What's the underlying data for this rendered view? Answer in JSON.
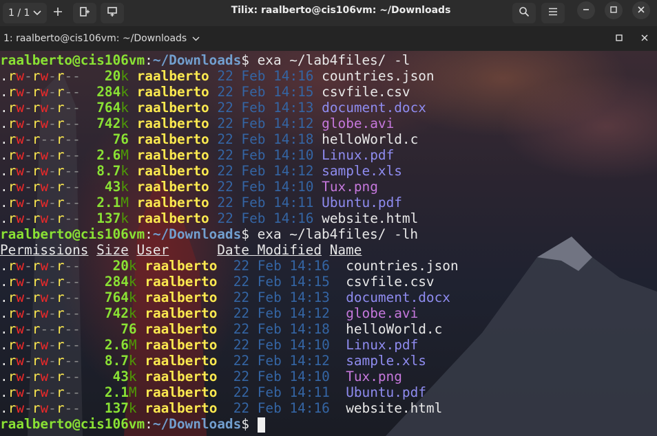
{
  "window": {
    "tab_counter": "1 / 1",
    "title": "Tilix: raalberto@cis106vm: ~/Downloads",
    "session_label": "1: raalberto@cis106vm: ~/Downloads"
  },
  "icons": {
    "chevron": "chevron-down-icon",
    "add": "plus-icon",
    "add_right": "add-terminal-right-icon",
    "add_down": "add-terminal-down-icon",
    "search": "search-icon",
    "menu": "hamburger-menu-icon",
    "minimize": "minimize-icon",
    "maximize": "maximize-icon",
    "close": "close-icon"
  },
  "terminal": {
    "prompt_user": "raalberto@cis106vm",
    "prompt_path": "~/Downloads",
    "prompt_symbol": "$",
    "command1": " exa ~/lab4files/ -l",
    "command2": " exa ~/lab4files/ -lh",
    "headers": [
      "Permissions",
      "Size",
      "User",
      "Date Modified",
      "Name"
    ],
    "perm_group_owner": [
      "rw",
      "rw",
      "rw",
      "rw",
      "rw",
      "rw",
      "rw",
      "rw",
      "rw",
      "rw"
    ],
    "files": [
      {
        "num": "20",
        "unit": "k",
        "date": "22 Feb 14:16",
        "name": "countries.json",
        "kind": "plain",
        "gw": true
      },
      {
        "num": "284",
        "unit": "k",
        "date": "22 Feb 14:15",
        "name": "csvfile.csv",
        "kind": "plain",
        "gw": true
      },
      {
        "num": "764",
        "unit": "k",
        "date": "22 Feb 14:13",
        "name": "document.docx",
        "kind": "doc",
        "gw": true
      },
      {
        "num": "742",
        "unit": "k",
        "date": "22 Feb 14:12",
        "name": "globe.avi",
        "kind": "media",
        "gw": true
      },
      {
        "num": "76",
        "unit": "",
        "date": "22 Feb 14:18",
        "name": "helloWorld.c",
        "kind": "plain",
        "gw": false
      },
      {
        "num": "2.6",
        "unit": "M",
        "date": "22 Feb 14:10",
        "name": "Linux.pdf",
        "kind": "doc",
        "gw": true
      },
      {
        "num": "8.7",
        "unit": "k",
        "date": "22 Feb 14:12",
        "name": "sample.xls",
        "kind": "doc",
        "gw": true
      },
      {
        "num": "43",
        "unit": "k",
        "date": "22 Feb 14:10",
        "name": "Tux.png",
        "kind": "media",
        "gw": true
      },
      {
        "num": "2.1",
        "unit": "M",
        "date": "22 Feb 14:11",
        "name": "Ubuntu.pdf",
        "kind": "doc",
        "gw": true
      },
      {
        "num": "137",
        "unit": "k",
        "date": "22 Feb 14:16",
        "name": "website.html",
        "kind": "plain",
        "gw": true
      }
    ]
  }
}
